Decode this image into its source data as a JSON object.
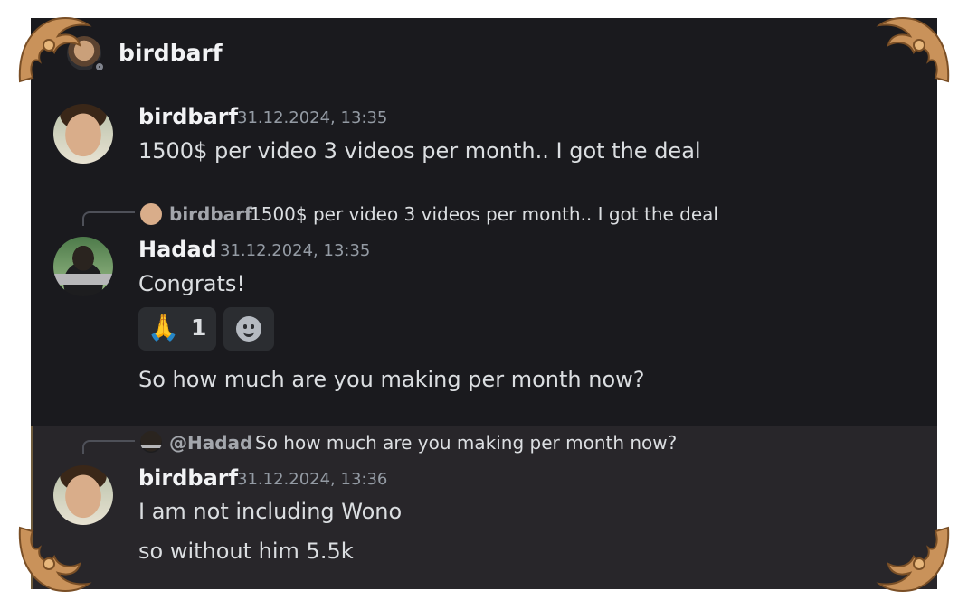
{
  "header": {
    "username": "birdbarf"
  },
  "messages": [
    {
      "author": "birdbarf",
      "timestamp": "31.12.2024, 13:35",
      "lines": [
        "1500$ per video 3 videos per month.. I got the deal"
      ]
    },
    {
      "reply_to": {
        "author": "birdbarf",
        "text": "1500$ per video 3 videos per month.. I got the deal"
      },
      "author": "Hadad",
      "timestamp": "31.12.2024, 13:35",
      "lines": [
        "Congrats!"
      ],
      "reaction": {
        "emoji": "🙏",
        "count": "1"
      },
      "followup": "So how much are you making per month now?"
    },
    {
      "reply_to": {
        "author": "@Hadad",
        "text": "So how much are you making per month now?"
      },
      "author": "birdbarf",
      "timestamp": "31.12.2024, 13:36",
      "lines": [
        "I am not including Wono",
        "so without him 5.5k"
      ]
    }
  ],
  "icons": {
    "status": "offline-status-icon",
    "add_reaction": "add-reaction-smile-icon",
    "corner": "baroque-corner-ornament"
  },
  "colors": {
    "background": "#1a1a1e",
    "highlight": "#28262a",
    "ornament": "#c9925a"
  }
}
